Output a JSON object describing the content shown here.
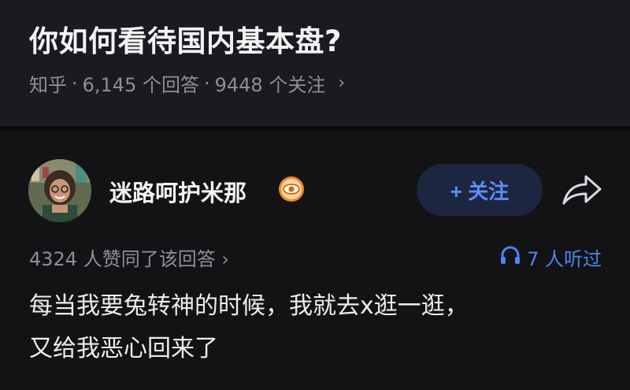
{
  "question": {
    "title": "你如何看待国内基本盘?",
    "source": "知乎",
    "separator": "·",
    "answers": "6,145 个回答",
    "followers": "9448 个关注",
    "chevron": "›"
  },
  "answer": {
    "author": "迷路呵护米那",
    "badge_icon": "eye-badge-icon",
    "follow_label": "+ 关注",
    "share_icon": "share-arrow-icon",
    "agree_text": "4324 人赞同了该回答 ›",
    "listen_icon": "headphones-icon",
    "listen_text": "7 人听过",
    "content_lines": [
      "每当我要兔转神的时候，我就去x逛一逛，",
      "又给我恶心回来了"
    ]
  },
  "colors": {
    "background": "#131316",
    "question_bg": "#1a1a1f",
    "accent_blue": "#4d84ee",
    "follow_bg": "#1c2640",
    "muted_text": "#8e8e96",
    "badge_orange": "#f08a1e"
  }
}
